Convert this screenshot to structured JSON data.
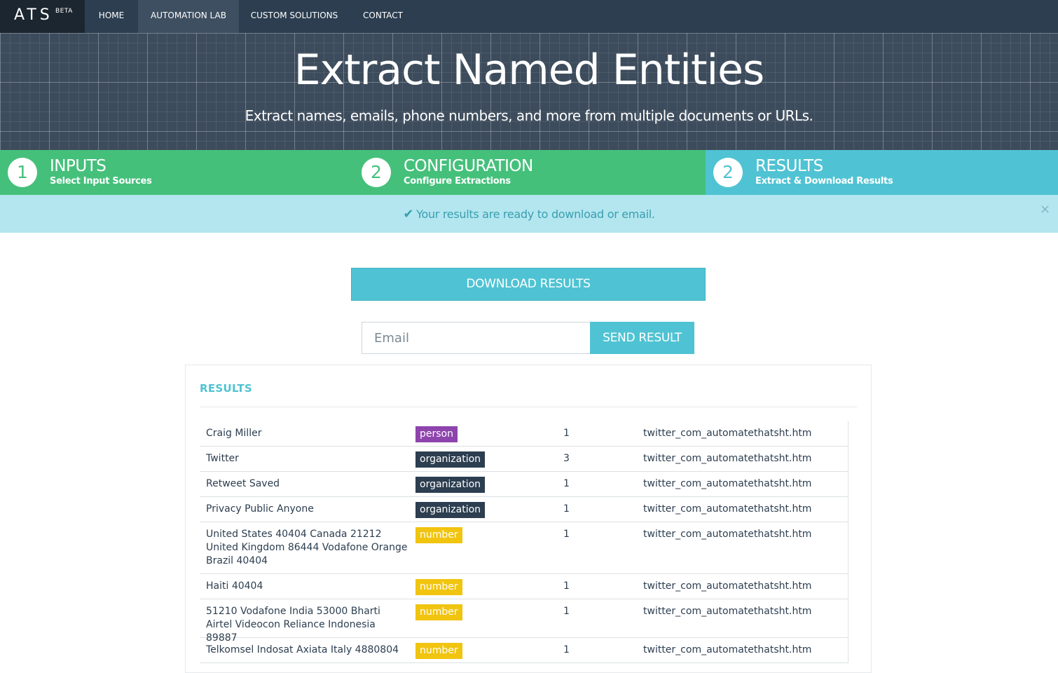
{
  "brand": {
    "name": "ATS",
    "sup": "BETA"
  },
  "nav": {
    "home": "HOME",
    "automation_lab": "AUTOMATION LAB",
    "custom_solutions": "CUSTOM SOLUTIONS",
    "contact": "CONTACT"
  },
  "hero": {
    "title": "Extract Named Entities",
    "subtitle": "Extract names, emails, phone numbers, and more from multiple documents or URLs."
  },
  "steps": [
    {
      "number": "1",
      "title": "INPUTS",
      "subtitle": "Select Input Sources"
    },
    {
      "number": "2",
      "title": "CONFIGURATION",
      "subtitle": "Configure Extractions"
    },
    {
      "number": "2",
      "title": "RESULTS",
      "subtitle": "Extract & Download Results"
    }
  ],
  "alert": {
    "message": "Your results are ready to download or email.",
    "close": "×",
    "check": "✔"
  },
  "actions": {
    "download_label": "DOWNLOAD RESULTS",
    "email_placeholder": "Email",
    "send_label": "SEND RESULT"
  },
  "results": {
    "title": "RESULTS",
    "rows": [
      {
        "name": "Craig Miller",
        "type": "person",
        "count": "1",
        "source": "twitter_com_automatethatsht.htm"
      },
      {
        "name": "Twitter",
        "type": "organization",
        "count": "3",
        "source": "twitter_com_automatethatsht.htm"
      },
      {
        "name": "Retweet Saved",
        "type": "organization",
        "count": "1",
        "source": "twitter_com_automatethatsht.htm"
      },
      {
        "name": "Privacy Public Anyone",
        "type": "organization",
        "count": "1",
        "source": "twitter_com_automatethatsht.htm"
      },
      {
        "name": "United States 40404 Canada 21212 United Kingdom 86444 Vodafone Orange Brazil 40404",
        "type": "number",
        "count": "1",
        "source": "twitter_com_automatethatsht.htm"
      },
      {
        "name": "Haiti 40404",
        "type": "number",
        "count": "1",
        "source": "twitter_com_automatethatsht.htm"
      },
      {
        "name": "51210 Vodafone India 53000 Bharti Airtel Videocon Reliance Indonesia 89887",
        "type": "number",
        "count": "1",
        "source": "twitter_com_automatethatsht.htm"
      },
      {
        "name": "Telkomsel Indosat Axiata Italy 4880804",
        "type": "number",
        "count": "1",
        "source": "twitter_com_automatethatsht.htm"
      }
    ]
  },
  "colors": {
    "nav": "#2c3e50",
    "step_done": "#45c07b",
    "step_active": "#4fc3d3",
    "alert_bg": "#b3e6ef",
    "badge_person": "#8e44ad",
    "badge_organization": "#2c3e50",
    "badge_number": "#f1c40f"
  }
}
